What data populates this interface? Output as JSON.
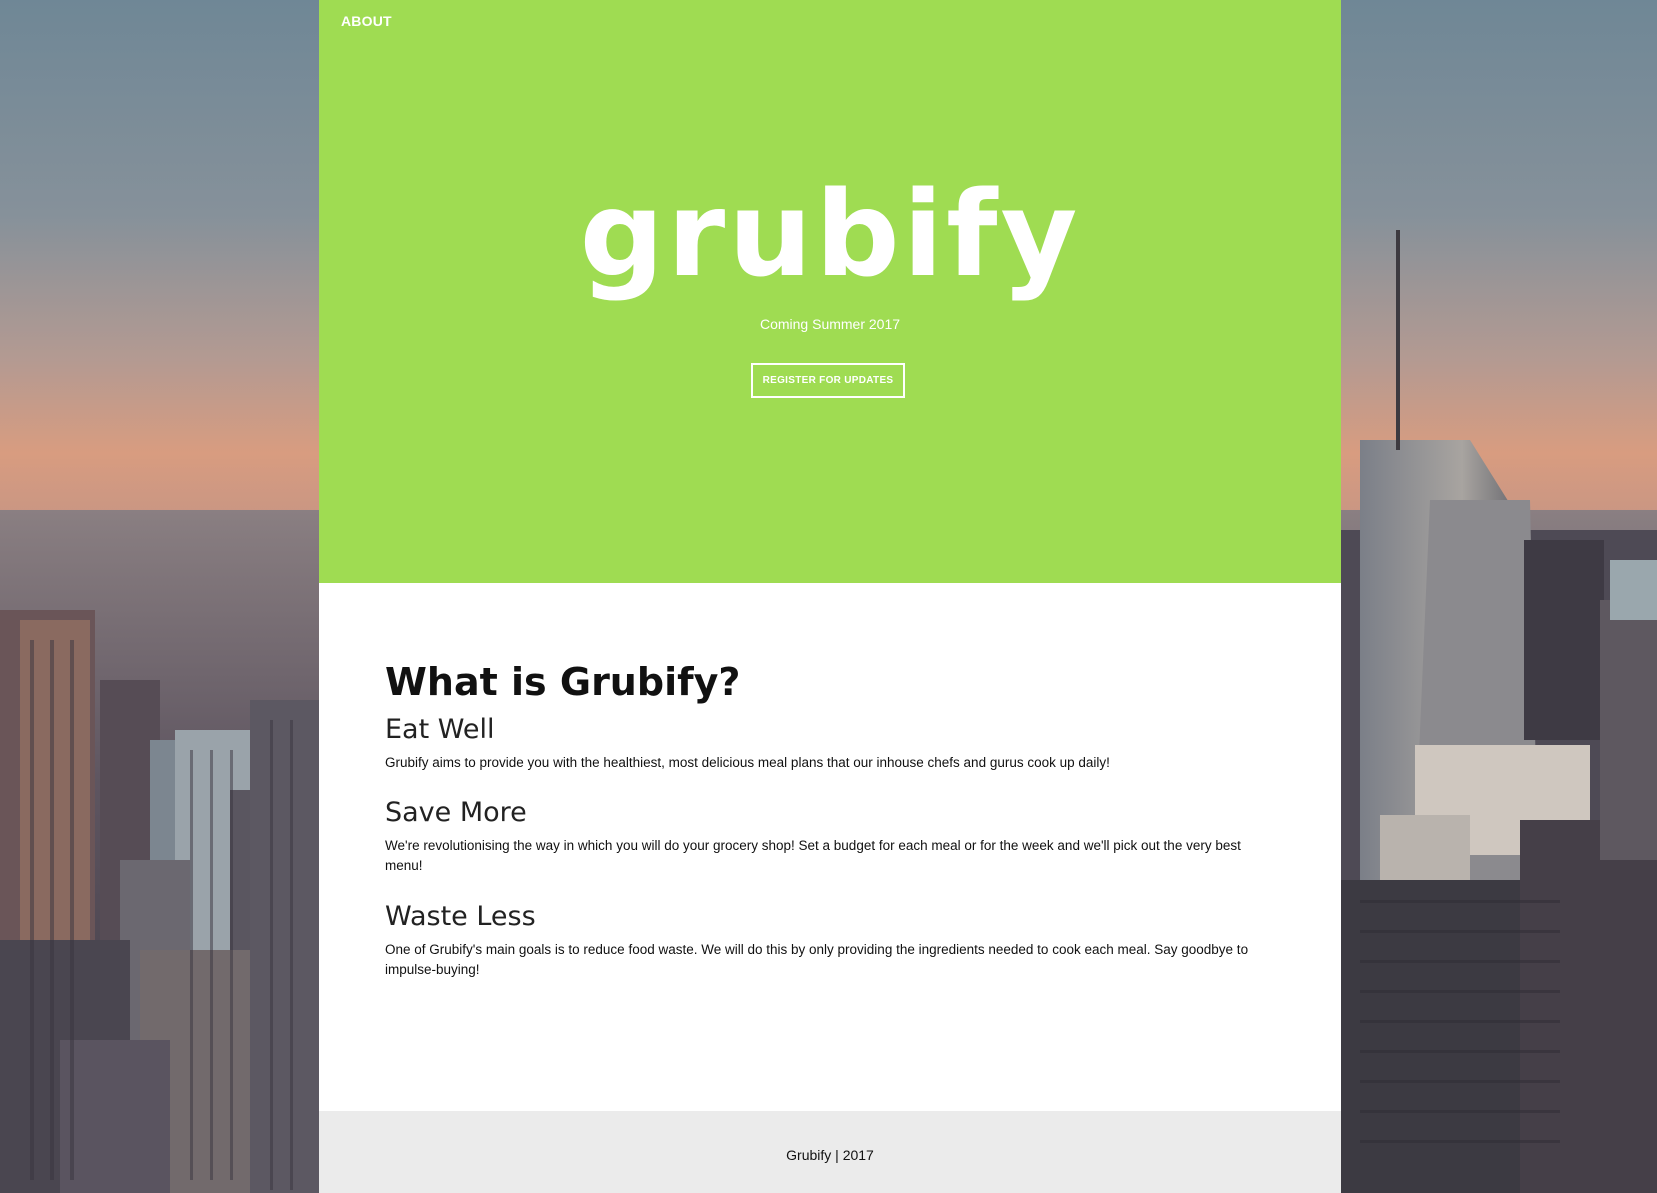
{
  "nav": {
    "about_label": "ABOUT"
  },
  "hero": {
    "logo_text": "grubify",
    "tagline": "Coming Summer 2017",
    "register_label": "REGISTER FOR UPDATES"
  },
  "content": {
    "heading": "What is Grubify?",
    "sections": [
      {
        "title": "Eat Well",
        "text": "Grubify aims to provide you with the healthiest, most delicious meal plans that our inhouse chefs and gurus cook up daily!"
      },
      {
        "title": "Save More",
        "text": "We're revolutionising the way in which you will do your grocery shop! Set a budget for each meal or for the week and we'll pick out the very best menu!"
      },
      {
        "title": "Waste Less",
        "text": "One of Grubify's main goals is to reduce food waste. We will do this by only providing the ingredients needed to cook each meal. Say goodbye to impulse-buying!"
      }
    ]
  },
  "footer": {
    "text": "Grubify | 2017"
  },
  "colors": {
    "brand_green": "#9fdc52",
    "content_bg": "#ffffff",
    "footer_bg": "#ebebeb"
  }
}
